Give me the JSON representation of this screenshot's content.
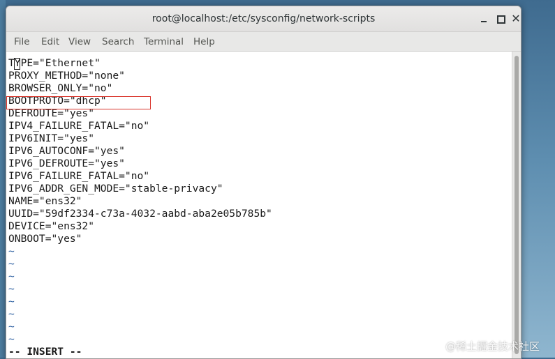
{
  "window": {
    "title": "root@localhost:/etc/sysconfig/network-scripts",
    "close_glyph": "✕"
  },
  "menu": [
    {
      "label": "File"
    },
    {
      "label": "Edit"
    },
    {
      "label": "View"
    },
    {
      "label": "Search"
    },
    {
      "label": "Terminal"
    },
    {
      "label": "Help"
    }
  ],
  "editor": {
    "lines": [
      "TYPE=\"Ethernet\"",
      "PROXY_METHOD=\"none\"",
      "BROWSER_ONLY=\"no\"",
      "BOOTPROTO=\"dhcp\"",
      "DEFROUTE=\"yes\"",
      "IPV4_FAILURE_FATAL=\"no\"",
      "IPV6INIT=\"yes\"",
      "IPV6_AUTOCONF=\"yes\"",
      "IPV6_DEFROUTE=\"yes\"",
      "IPV6_FAILURE_FATAL=\"no\"",
      "IPV6_ADDR_GEN_MODE=\"stable-privacy\"",
      "NAME=\"ens32\"",
      "UUID=\"59df2334-c73a-4032-aabd-aba2e05b785b\"",
      "DEVICE=\"ens32\"",
      "ONBOOT=\"yes\""
    ],
    "empty_line_marker": "~",
    "mode_indicator": "-- INSERT --"
  },
  "watermark": "@稀土掘金技术社区",
  "colors": {
    "highlight_box": "#d9342b",
    "tilde": "#3465a4",
    "terminal_bg": "#ffffff"
  }
}
